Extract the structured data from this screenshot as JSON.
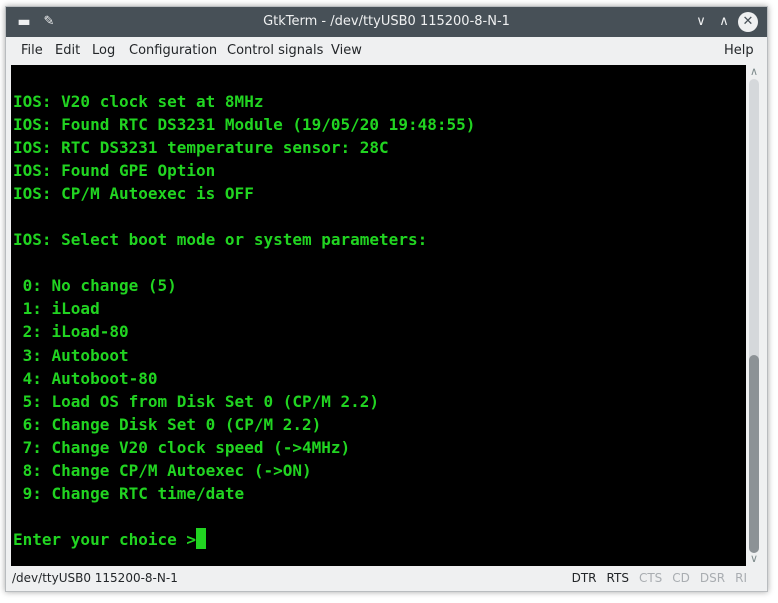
{
  "window": {
    "title": "GtkTerm - /dev/ttyUSB0 115200-8-N-1",
    "app_icon": "▬",
    "pin_icon": "✎",
    "min_icon": "∨",
    "max_icon": "∧",
    "close_icon": "✕"
  },
  "menu": {
    "file": "File",
    "edit": "Edit",
    "log": "Log",
    "configuration": "Configuration",
    "control_signals": "Control signals",
    "view": "View",
    "help": "Help"
  },
  "terminal": {
    "text": "IOS: V20 clock set at 8MHz\nIOS: Found RTC DS3231 Module (19/05/20 19:48:55)\nIOS: RTC DS3231 temperature sensor: 28C\nIOS: Found GPE Option\nIOS: CP/M Autoexec is OFF\n\nIOS: Select boot mode or system parameters:\n\n 0: No change (5)\n 1: iLoad\n 2: iLoad-80\n 3: Autoboot\n 4: Autoboot-80\n 5: Load OS from Disk Set 0 (CP/M 2.2)\n 6: Change Disk Set 0 (CP/M 2.2)\n 7: Change V20 clock speed (->4MHz)\n 8: Change CP/M Autoexec (->ON)\n 9: Change RTC time/date\n\nEnter your choice >",
    "text_color": "#21d421",
    "background": "#000000"
  },
  "scrollbar": {
    "up_icon": "∧",
    "down_icon": "∨",
    "position_fraction": 1.0
  },
  "status": {
    "port": "/dev/ttyUSB0  115200-8-N-1",
    "dtr": "DTR",
    "rts": "RTS",
    "cts": "CTS",
    "cd": "CD",
    "dsr": "DSR",
    "ri": "RI"
  }
}
